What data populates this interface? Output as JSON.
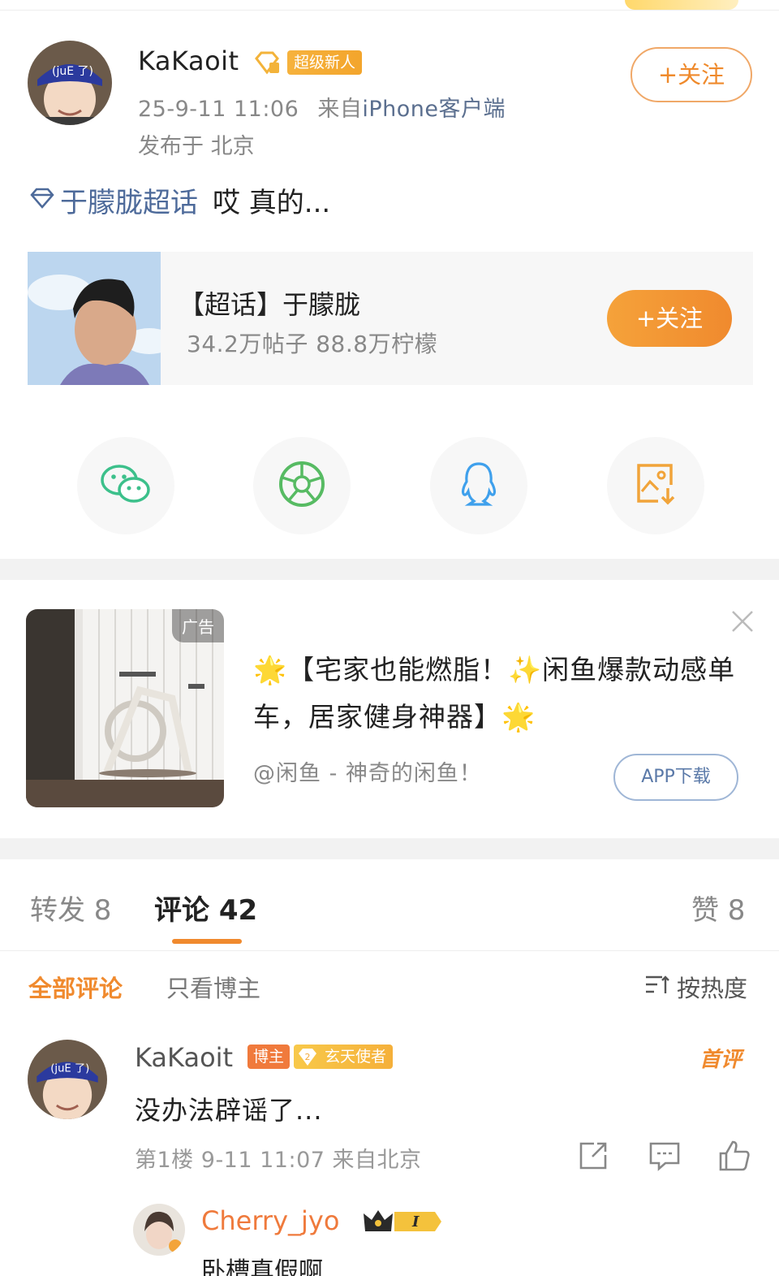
{
  "post": {
    "username": "KaKaoit",
    "badge": "超级新人",
    "timestamp": "25-9-11 11:06",
    "source_prefix": "来自",
    "source": "iPhone客户端",
    "location": "发布于 北京",
    "follow_label": "+关注",
    "topic_tag": "于朦胧超话",
    "text": "哎 真的..."
  },
  "topic_card": {
    "title": "【超话】于朦胧",
    "stats": "34.2万帖子  88.8万柠檬",
    "follow_label": "+关注"
  },
  "share": {
    "items": [
      "wechat-icon",
      "moments-icon",
      "qq-icon",
      "save-image-icon"
    ]
  },
  "ad": {
    "tag": "广告",
    "text": "🌟【宅家也能燃脂！✨闲鱼爆款动感单车，居家健身神器】🌟",
    "source": "@闲鱼 - 神奇的闲鱼！",
    "button": "APP下载"
  },
  "tabs": {
    "repost": "转发 8",
    "comments": "评论 42",
    "likes": "赞 8",
    "active": "comments"
  },
  "filters": {
    "all": "全部评论",
    "host_only": "只看博主",
    "sort": "按热度"
  },
  "comment": {
    "username": "KaKaoit",
    "host_badge": "博主",
    "level": "2",
    "title_badge": "玄天使者",
    "first_tag": "首评",
    "text": "没办法辟谣了...",
    "meta": "第1楼  9-11 11:07  来自北京"
  },
  "reply": {
    "username": "Cherry_jyo",
    "level": "I",
    "text": "卧槽真假啊"
  },
  "colors": {
    "accent": "#f08a2e",
    "link": "#4d6a9a",
    "gray_text": "#888888"
  }
}
